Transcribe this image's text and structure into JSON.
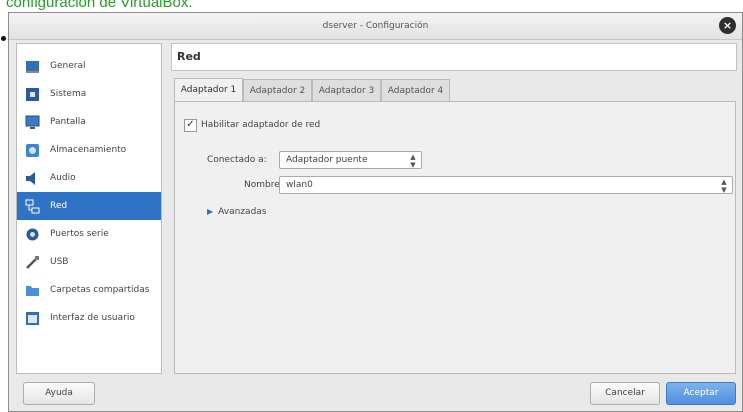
{
  "caption": "configuración de VirtualBox.",
  "window": {
    "title": "dserver - Configuración",
    "close_glyph": "×"
  },
  "sidebar": {
    "items": [
      {
        "label": "General",
        "icon": "general-icon"
      },
      {
        "label": "Sistema",
        "icon": "system-icon"
      },
      {
        "label": "Pantalla",
        "icon": "display-icon"
      },
      {
        "label": "Almacenamiento",
        "icon": "storage-icon"
      },
      {
        "label": "Audio",
        "icon": "audio-icon"
      },
      {
        "label": "Red",
        "icon": "network-icon",
        "selected": true
      },
      {
        "label": "Puertos serie",
        "icon": "serial-ports-icon"
      },
      {
        "label": "USB",
        "icon": "usb-icon"
      },
      {
        "label": "Carpetas compartidas",
        "icon": "shared-folders-icon"
      },
      {
        "label": "Interfaz de usuario",
        "icon": "user-interface-icon"
      }
    ]
  },
  "main": {
    "title": "Red",
    "tabs": [
      "Adaptador 1",
      "Adaptador 2",
      "Adaptador 3",
      "Adaptador 4"
    ],
    "active_tab": 0,
    "enable_adapter": {
      "label": "Habilitar adaptador de red",
      "checked": true,
      "check_glyph": "✓"
    },
    "attached_to": {
      "label": "Conectado a:",
      "value": "Adaptador puente"
    },
    "name": {
      "label": "Nombre:",
      "value": "wlan0"
    },
    "advanced": {
      "label": "Avanzadas",
      "glyph": "▶"
    },
    "select_glyph": "▲▼"
  },
  "buttons": {
    "help": "Ayuda",
    "cancel": "Cancelar",
    "accept": "Aceptar"
  },
  "colors": {
    "selection": "#2f73c6",
    "caption": "#22a022",
    "accent": "#4f8fe0"
  }
}
